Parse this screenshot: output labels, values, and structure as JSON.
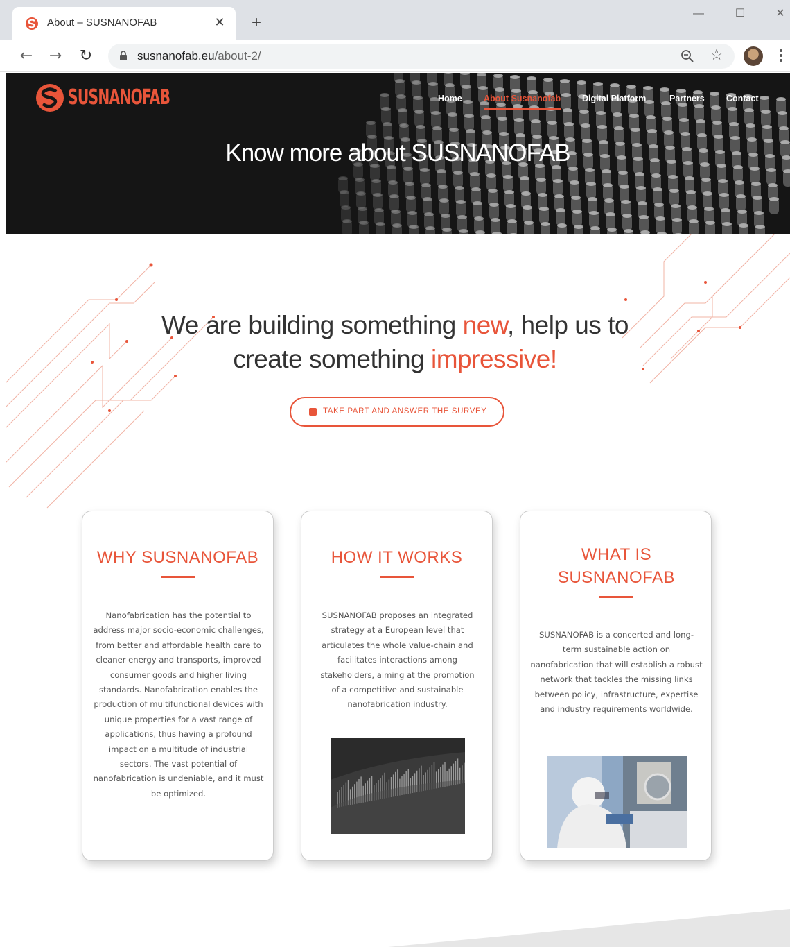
{
  "browser": {
    "tab_title": "About – SUSNANOFAB",
    "new_tab_label": "+",
    "url_host": "susnanofab.eu",
    "url_path": "/about-2/"
  },
  "site": {
    "logo_text": "SUSNANOFAB",
    "nav": {
      "home": "Home",
      "about": "About Susnanofab",
      "digital": "Digital Platform",
      "partners": "Partners",
      "contact": "Contact"
    },
    "hero_title": "Know more about SUSNANOFAB"
  },
  "headline": {
    "part1": "We are building something ",
    "accent1": "new",
    "part2": ", help us to create something ",
    "accent2": "impressive!"
  },
  "survey_button": {
    "label": "TAKE PART AND ANSWER THE SURVEY"
  },
  "cards": [
    {
      "title": "WHY SUSNANOFAB",
      "body": "Nanofabrication has the potential to address major socio-economic challenges, from better and affordable health care to cleaner energy and transports, improved consumer goods and higher living standards. Nanofabrication enables the production of multifunctional devices with unique properties for a vast range of applications, thus having a profound impact on a multitude of industrial sectors. The vast potential of nanofabrication is undeniable, and it must be optimized."
    },
    {
      "title": "HOW IT WORKS",
      "body": "SUSNANOFAB proposes an integrated strategy at a European level that articulates the whole value-chain and facilitates interactions among stakeholders, aiming at the promotion of a competitive and sustainable nanofabrication industry."
    },
    {
      "title": "WHAT IS SUSNANOFAB",
      "body": "SUSNANOFAB is a concerted and long-term sustainable action on nanofabrication that will establish a robust network that tackles the missing links between policy, infrastructure, expertise and industry requirements worldwide."
    }
  ],
  "colors": {
    "accent": "#e8553a",
    "hero_bg": "#151515",
    "text": "#555555"
  }
}
